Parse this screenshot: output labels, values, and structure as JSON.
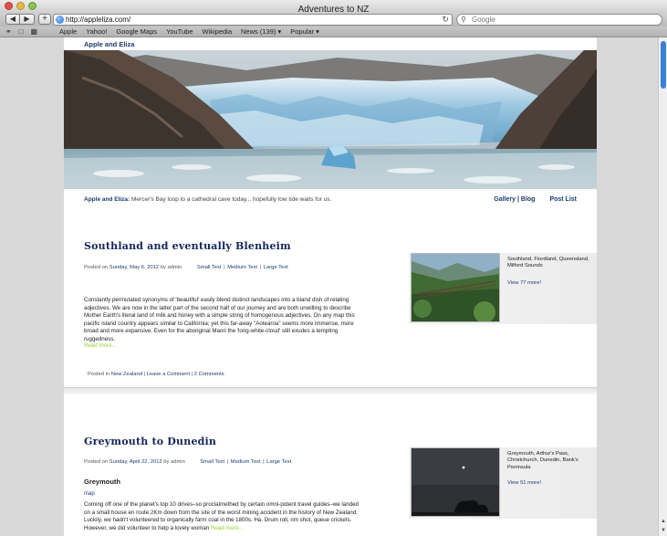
{
  "window": {
    "title": "Adventures to NZ"
  },
  "toolbar": {
    "back": "◀",
    "forward": "▶",
    "add": "+",
    "url": "http://appleliza.com/",
    "reload": "↻",
    "search_placeholder": "Google"
  },
  "bookmarks": {
    "items": [
      "Apple",
      "Yahoo!",
      "Google Maps",
      "YouTube",
      "Wikipedia",
      "News (139) ▾",
      "Popular ▾"
    ]
  },
  "site": {
    "title": "Apple and Eliza",
    "tagline_name": "Apple and Eliza:",
    "tagline_text": " Mercer's Bay loop to a cathedral cave today... hopefully low tide waits for us.",
    "nav": {
      "gallery": "Gallery | Blog",
      "post_list": "Post List"
    }
  },
  "posts": [
    {
      "title": "Southland and eventually Blenheim",
      "posted_on": "Posted on",
      "date": "Sunday, May 6, 2012",
      "by": "by admin",
      "sizes": [
        "Small Text",
        "Medium Text",
        "Large Text"
      ],
      "excerpt": "Constantly permutated synonyms of 'beautiful' easily blend distinct landscapes into a bland dish of relating adjectives. We are now in the latter part of the second half of our journey and are both unwilling to describe Mother Earth's literal land of milk and honey with a simple string of homogenous adjectives. On any map this pacific island country appears similar to California; yet this far-away \"Aotearoa\" seems more immense, more broad and more expansive. Even for the aboriginal Maori the 'long-white-cloud' still exudes a tempting ruggedness.",
      "read_more": "Read more...",
      "posted_in": "Posted in",
      "category": "New Zealand",
      "leave_comment": "Leave a Comment",
      "comments": "2 Comments",
      "side_locations": "Southland, Fiordland, Queensland, Milford Sounds",
      "side_more": "View 77 more!"
    },
    {
      "title": "Greymouth to Dunedin",
      "posted_on": "Posted on",
      "date": "Sunday, April 22, 2012",
      "by": "by admin",
      "sizes": [
        "Small Text",
        "Medium Text",
        "Large Text"
      ],
      "subheading": "Greymouth",
      "map": "map",
      "excerpt": "Coming off one of the planet's top 10 drives–so proclaimethed by certain omni-potent travel guides–we landed on a small house en route 2Km down from the site of the worst mining accident in the history of New Zealand. Luckily, we hadn't volunteered to organically farm coal in the 1800s. Ha. Drum roll, rim shot, queue crickets. However, we did volunteer to help a lovely woman",
      "read_more": "Read more...",
      "side_locations": "Greymouth, Arthur's Pass, Christchurch, Dunedin, Bank's Peninsula",
      "side_more": "View 51 more!"
    }
  ]
}
